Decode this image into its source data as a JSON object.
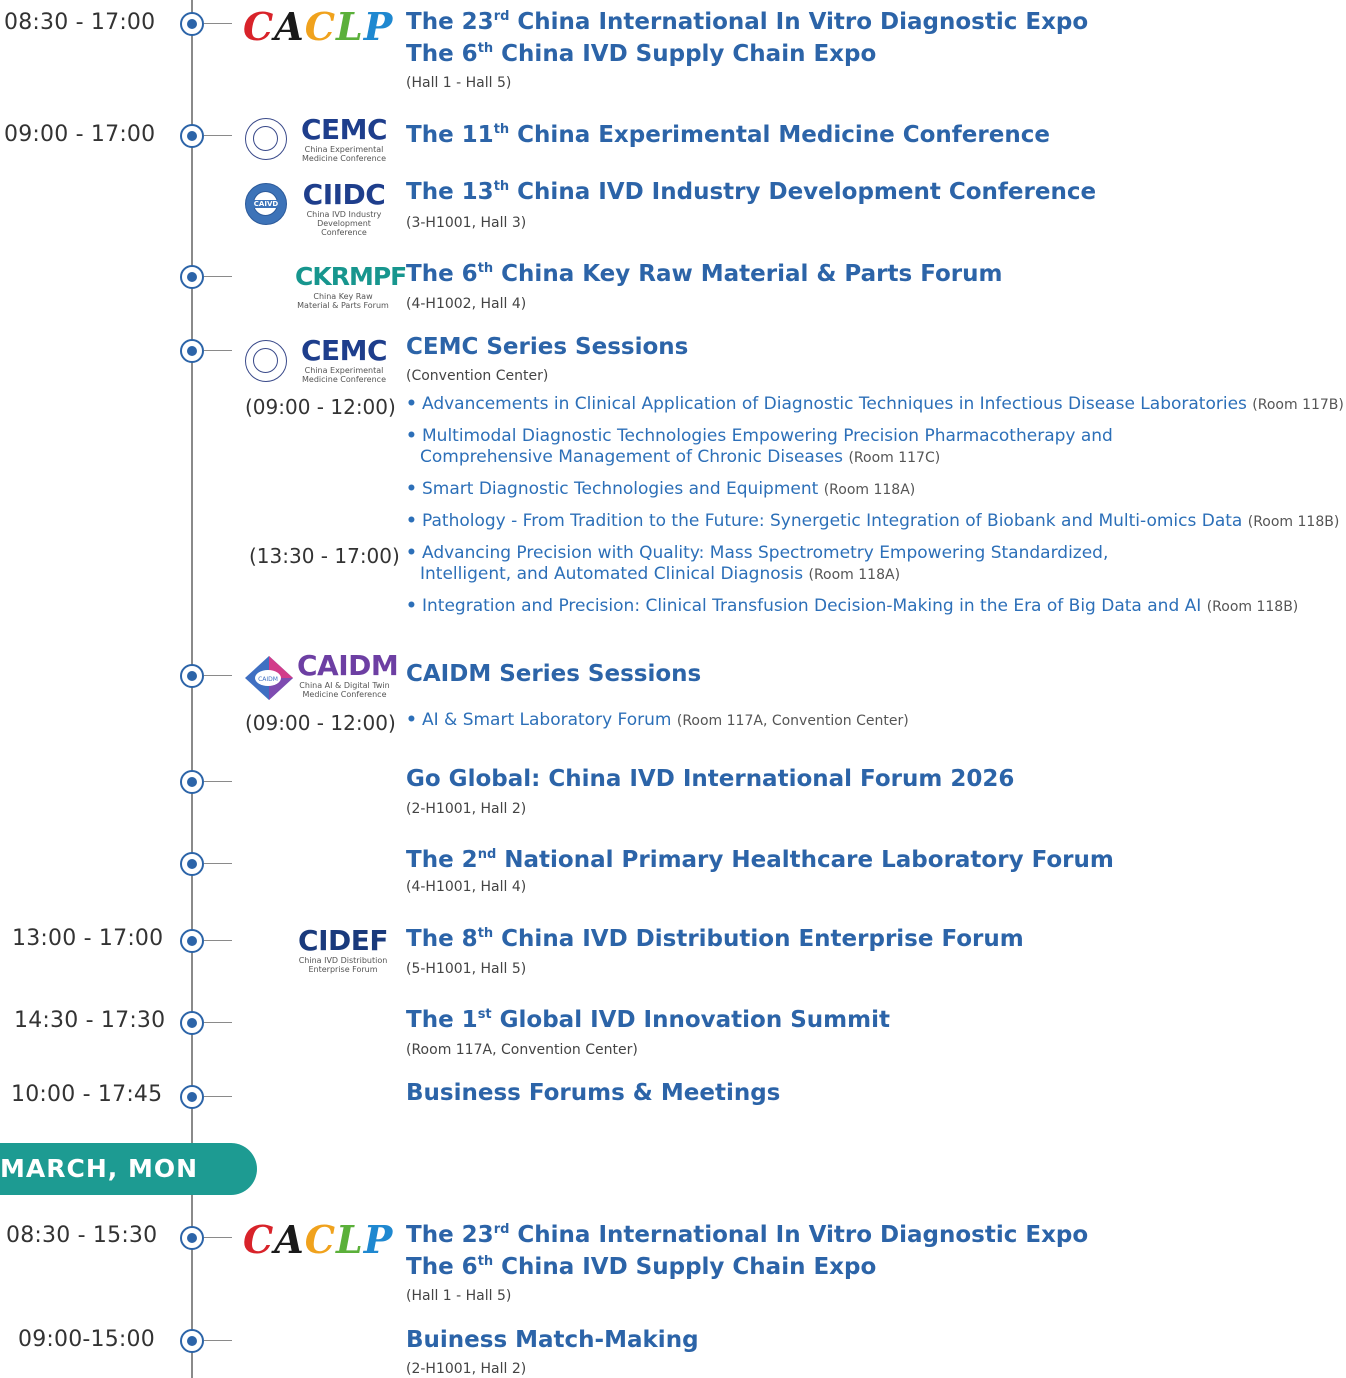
{
  "day2": {
    "banner": "MARCH, MON"
  },
  "logos": {
    "caclp": [
      "C",
      "A",
      "C",
      "L",
      "P"
    ],
    "cemc": {
      "name": "CEMC",
      "sub1": "China Experimental",
      "sub2": "Medicine Conference"
    },
    "ciidc": {
      "name": "CIIDC",
      "sub1": "China IVD Industry",
      "sub2": "Development Conference",
      "seal": "CAIVD"
    },
    "ckrmpf": {
      "name": "CKRMPF",
      "sub1": "China Key Raw",
      "sub2": "Material & Parts Forum"
    },
    "caidm": {
      "name": "CAIDM",
      "sub1": "China AI & Digital Twin",
      "sub2": "Medicine Conference",
      "badge": "CAIDM"
    },
    "cidef": {
      "name": "CIDEF",
      "sub1": "China IVD Distribution",
      "sub2": "Enterprise Forum"
    }
  },
  "events": [
    {
      "time": "08:30 - 17:00",
      "title_a": "The 23",
      "sup": "rd",
      "title_b": " China International In Vitro Diagnostic Expo",
      "title2_a": "The 6",
      "sup2": "th",
      "title2_b": " China IVD Supply Chain Expo",
      "venue": "(Hall 1 - Hall 5)"
    },
    {
      "time": "09:00 - 17:00",
      "title_a": "The 11",
      "sup": "th",
      "title_b": " China Experimental Medicine Conference"
    },
    {
      "title_a": "The 13",
      "sup": "th",
      "title_b": " China IVD Industry Development Conference",
      "venue": "(3-H1001, Hall 3)"
    },
    {
      "title_a": "The 6",
      "sup": "th",
      "title_b": " China Key Raw Material & Parts Forum",
      "venue": "(4-H1002, Hall 4)"
    },
    {
      "title": "CEMC Series Sessions",
      "venue": "(Convention Center)",
      "am": "(09:00 - 12:00)",
      "pm": "(13:30 - 17:00)",
      "sessions": [
        {
          "text": "Advancements in Clinical Application of Diagnostic Techniques in Infectious Disease Laboratories",
          "room": "(Room 117B)"
        },
        {
          "text": "Multimodal Diagnostic Technologies Empowering Precision Pharmacotherapy and",
          "text2": "Comprehensive Management of Chronic Diseases",
          "room": "(Room 117C)"
        },
        {
          "text": "Smart Diagnostic Technologies and Equipment",
          "room": "(Room 118A)"
        },
        {
          "text": "Pathology - From Tradition to the Future: Synergetic Integration of Biobank and Multi-omics Data",
          "room": "(Room 118B)"
        },
        {
          "text": "Advancing Precision with Quality: Mass Spectrometry Empowering Standardized,",
          "text2": "Intelligent, and Automated Clinical Diagnosis",
          "room": "(Room 118A)"
        },
        {
          "text": "Integration and Precision: Clinical Transfusion Decision-Making in the Era of Big Data and AI",
          "room": "(Room 118B)"
        }
      ]
    },
    {
      "title": "CAIDM Series Sessions",
      "am": "(09:00 - 12:00)",
      "sessions": [
        {
          "text": "AI & Smart Laboratory Forum",
          "room": "(Room 117A, Convention Center)"
        }
      ]
    },
    {
      "title": "Go Global: China IVD International Forum 2026",
      "venue": "(2-H1001, Hall 2)"
    },
    {
      "title_a": "The 2",
      "sup": "nd",
      "title_b": " National Primary Healthcare Laboratory Forum",
      "venue": "(4-H1001, Hall 4)"
    },
    {
      "time": "13:00 - 17:00",
      "title_a": "The 8",
      "sup": "th",
      "title_b": " China IVD Distribution Enterprise Forum",
      "venue": "(5-H1001, Hall 5)"
    },
    {
      "time": "14:30 - 17:30",
      "title_a": "The 1",
      "sup": "st",
      "title_b": " Global IVD Innovation Summit",
      "venue": "(Room 117A, Convention Center)"
    },
    {
      "time": "10:00 - 17:45",
      "title": "Business Forums & Meetings"
    },
    {
      "time": "08:30 - 15:30",
      "title_a": "The 23",
      "sup": "rd",
      "title_b": " China International In Vitro Diagnostic Expo",
      "title2_a": "The 6",
      "sup2": "th",
      "title2_b": " China IVD Supply Chain Expo",
      "venue": "(Hall 1 - Hall 5)"
    },
    {
      "time": "09:00-15:00",
      "title": "Buiness Match-Making",
      "venue": "(2-H1001, Hall 2)"
    }
  ]
}
